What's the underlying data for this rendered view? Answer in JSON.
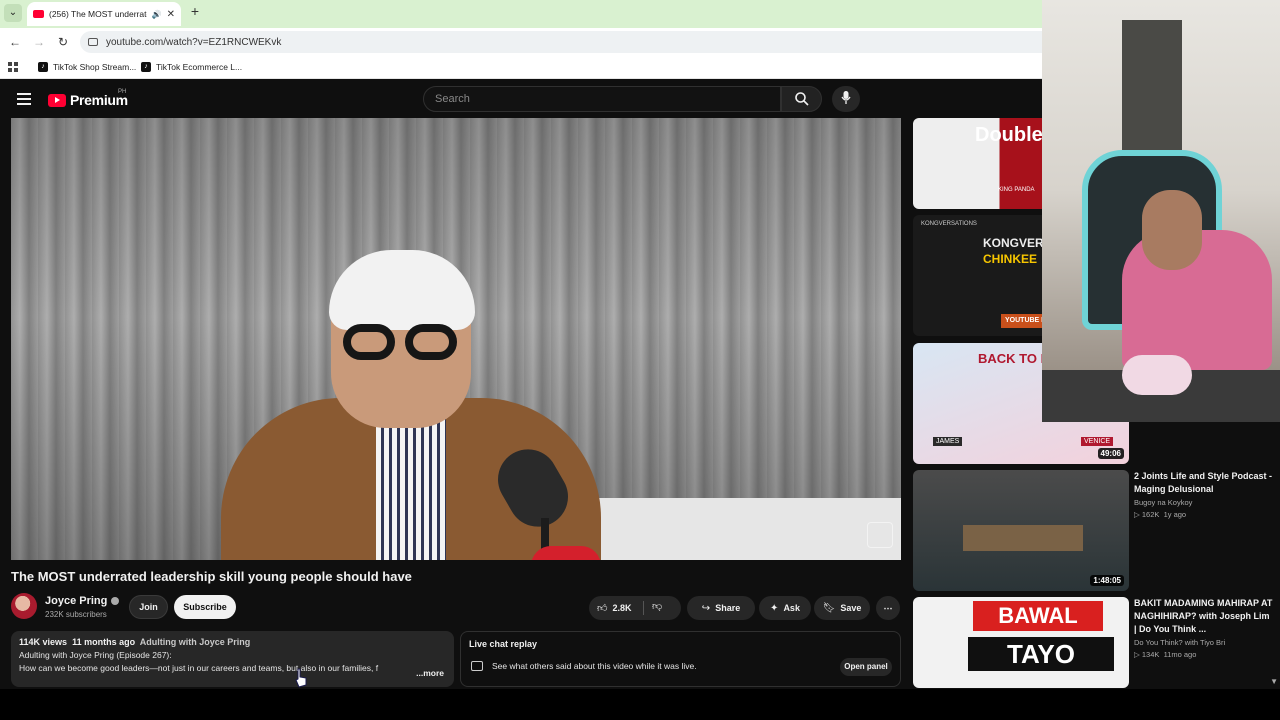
{
  "browser": {
    "tab": {
      "title": "(256) The MOST underrated leadership skill young people should have"
    },
    "url": "youtube.com/watch?v=EZ1RNCWEKvk",
    "bookmarks": [
      "TikTok Shop Stream...",
      "TikTok Ecommerce L..."
    ]
  },
  "header": {
    "logo_text": "Premium",
    "region": "PH",
    "search_placeholder": "Search"
  },
  "video": {
    "title": "The MOST underrated leadership skill young people should have",
    "watermark_icon": "channel-watermark-icon"
  },
  "channel": {
    "name": "Joyce Pring",
    "subscribers": "232K subscribers",
    "join_label": "Join",
    "subscribe_label": "Subscribe"
  },
  "actions": {
    "likes": "2.8K",
    "share": "Share",
    "ask": "Ask",
    "save": "Save"
  },
  "description": {
    "views": "114K views",
    "age": "11 months ago",
    "tag": "Adulting with Joyce Pring",
    "line1": "Adulting with Joyce Pring (Episode 267):",
    "line2": "How can we become good leaders—not just in our careers and teams, but also in our families, f",
    "more": "...more"
  },
  "live_chat": {
    "title": "Live chat replay",
    "text": "See what others said about this video while it was live.",
    "button": "Open panel"
  },
  "sidebar": {
    "thumbs": [
      {
        "text": "Double My Inco",
        "sub": "KING PANDA"
      },
      {
        "text_a": "KONGVERSA",
        "text_b": "CHINKEE",
        "badge": "YOUTUBE PODCAST EPISODE 5",
        "brand": "KONGVERSATIONS"
      },
      {
        "text": "BACK TO R",
        "duration": "49:06",
        "name1": "JAMES",
        "name2": "VENICE"
      },
      {
        "duration": "1:48:05"
      },
      {
        "text_a": "BAWAL",
        "text_b": "TAYO"
      }
    ],
    "videos": [
      {
        "title": "2 Joints Life and Style Podcast - Maging Delusional",
        "channel": "Bugoy na Koykoy",
        "views": "162K",
        "age": "1y ago"
      },
      {
        "title": "BAKIT MADAMING MAHIRAP AT NAGHIHIRAP? with Joseph Lim | Do You Think ...",
        "channel": "Do You Think? with Tiyo Bri",
        "views": "134K",
        "age": "11mo ago"
      }
    ]
  }
}
